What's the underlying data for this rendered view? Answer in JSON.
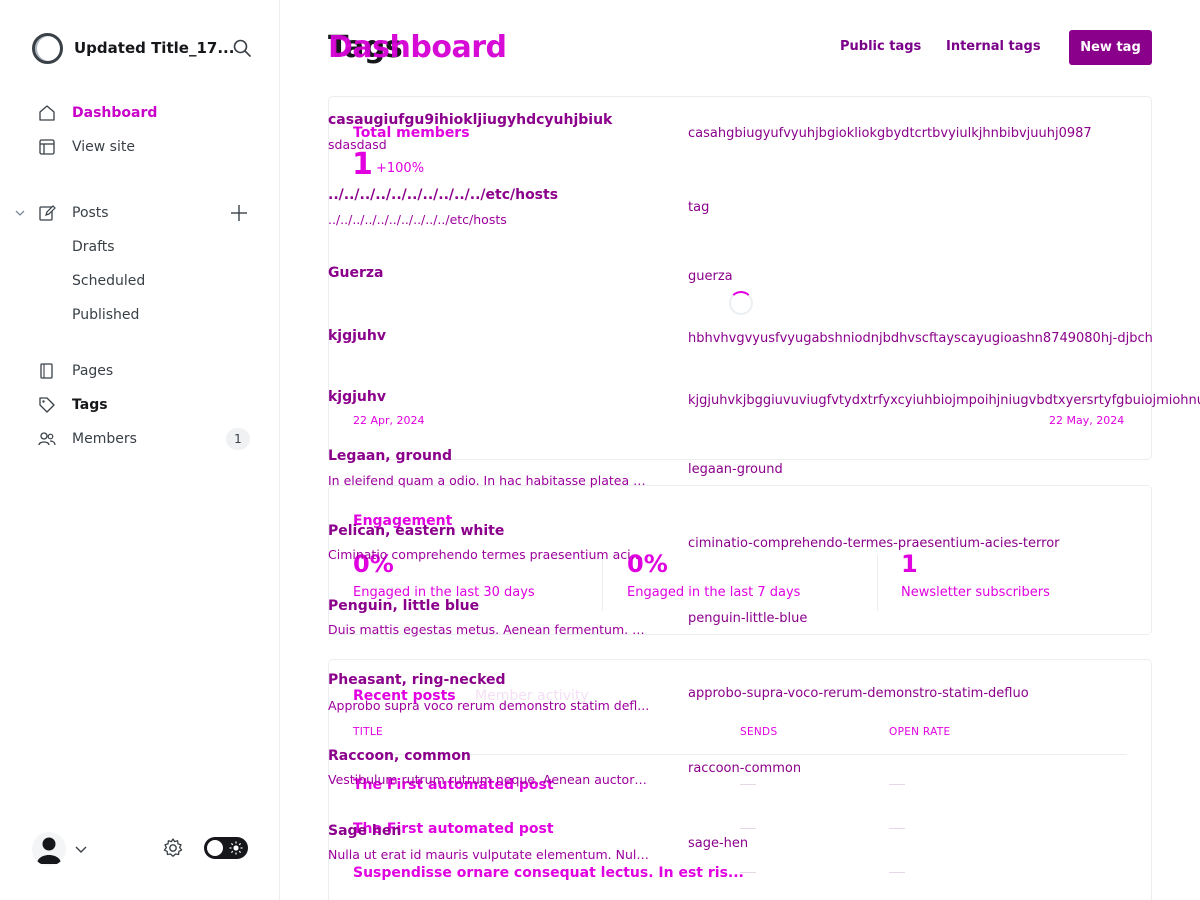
{
  "sidebar": {
    "site_title": "Updated Title_17...",
    "nav": {
      "dashboard": "Dashboard",
      "view_site": "View site",
      "posts": "Posts",
      "drafts": "Drafts",
      "scheduled": "Scheduled",
      "published": "Published",
      "pages": "Pages",
      "tags": "Tags",
      "members": "Members",
      "members_count": "1"
    }
  },
  "header": {
    "title": "Tags",
    "ghost_title": "Dashboard",
    "public_tags": "Public tags",
    "internal_tags": "Internal tags",
    "new_tag": "New tag"
  },
  "dashboard": {
    "total_members_label": "Total members",
    "total_members_value": "1",
    "total_members_change": "+100%",
    "date_start": "22 Apr, 2024",
    "date_end": "22 May, 2024",
    "engagement_title": "Engagement",
    "stats": [
      {
        "value": "0%",
        "label": "Engaged in the last 30 days"
      },
      {
        "value": "0%",
        "label": "Engaged in the last 7 days"
      },
      {
        "value": "1",
        "label": "Newsletter subscribers"
      }
    ],
    "tab_recent_posts": "Recent posts",
    "tab_member_activity": "Member activity",
    "col_title": "TITLE",
    "col_sends": "SENDS",
    "col_open_rate": "OPEN RATE",
    "posts": [
      "The First automated post",
      "The First automated post",
      "Suspendisse ornare consequat lectus. In est ris..."
    ]
  },
  "tags": [
    {
      "name": "casaugiufgu9ihiokljiugyhdcyuhjbiuk",
      "desc": "sdasdasd",
      "slug": "casahgbiugyufvyuhjbgiokliokgbydtcrtbvyiulkjhnbibvjuuhj0987"
    },
    {
      "name": "../../../../../../../../../../etc/hosts",
      "desc": "../../../../../../../../../../etc/hosts",
      "slug": "tag"
    },
    {
      "name": "Guerza",
      "desc": "",
      "slug": "guerza"
    },
    {
      "name": "kjgjuhv",
      "desc": "",
      "slug": "hbhvhvgvyusfvyugabshniodnjbdhvscftayscayugioashn8749080hj-djbch"
    },
    {
      "name": "kjgjuhv",
      "desc": "",
      "slug": "kjgjuhvkjbggiuvuviugfvtydxtrfyxcyiuhbiojmpoihjniugvbdtxyersrtyfgbuiojmiohnuif"
    },
    {
      "name": "Legaan, ground",
      "desc": "In eleifend quam a odio. In hac habitasse platea d...",
      "slug": "legaan-ground"
    },
    {
      "name": "Pelican, eastern white",
      "desc": "Ciminatio comprehendo termes praesentium acie...",
      "slug": "ciminatio-comprehendo-termes-praesentium-acies-terror"
    },
    {
      "name": "Penguin, little blue",
      "desc": "Duis mattis egestas metus. Aenean fermentum. D...",
      "slug": "penguin-little-blue"
    },
    {
      "name": "Pheasant, ring-necked",
      "desc": "Approbo supra voco rerum demonstro statim defl...",
      "slug": "approbo-supra-voco-rerum-demonstro-statim-defluo"
    },
    {
      "name": "Raccoon, common",
      "desc": "Vestibulum rutrum rutrum neque. Aenean auctor ...",
      "slug": "raccoon-common"
    },
    {
      "name": "Sage hen",
      "desc": "Nulla ut erat id mauris vulputate elementum. Null...",
      "slug": "sage-hen"
    }
  ],
  "colors": {
    "accent": "#8b008b",
    "ghost_magenta": "#e000e0",
    "text": "#15171a",
    "muted": "#394047"
  }
}
